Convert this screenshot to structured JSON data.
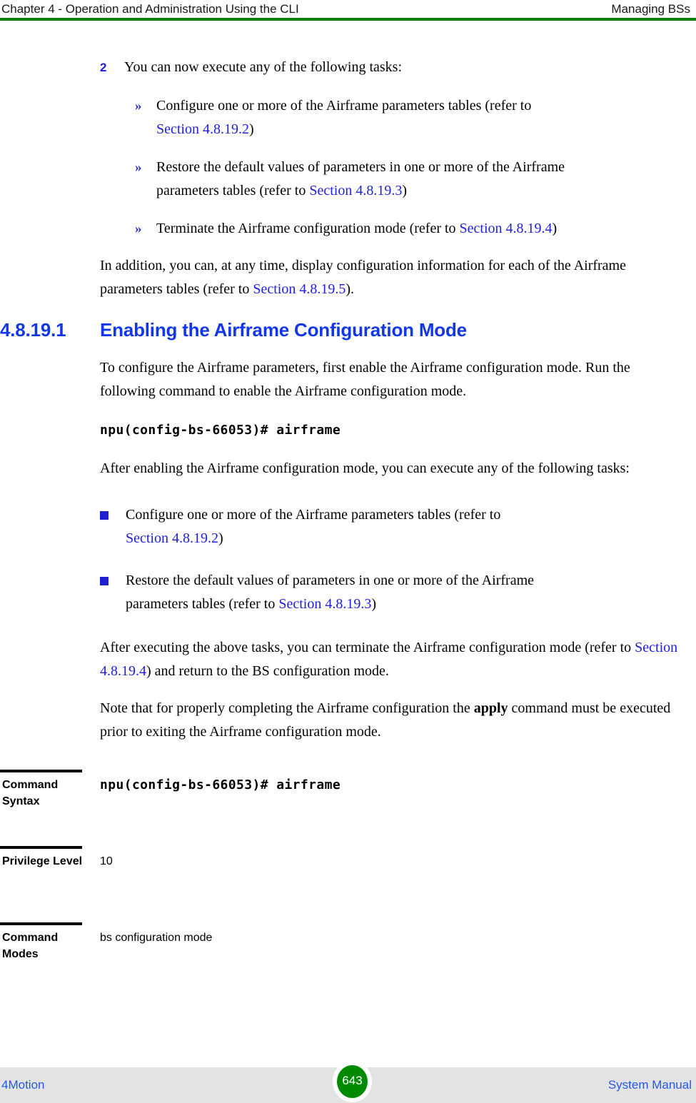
{
  "header": {
    "left": "Chapter 4 - Operation and Administration Using the CLI",
    "right": "Managing BSs",
    "rule_color": "#008000"
  },
  "step": {
    "number": "2",
    "text": "You can now execute any of the following tasks:"
  },
  "chevron_items": [
    {
      "marker": "»",
      "line1": "Configure one or more of the Airframe parameters tables (refer to",
      "ref": "Section 4.8.19.2",
      "tail": ")"
    },
    {
      "marker": "»",
      "line1": "Restore the default values of parameters in one or more of the Airframe",
      "line2_prefix": "parameters tables (refer to ",
      "ref": "Section 4.8.19.3",
      "tail": ")"
    },
    {
      "marker": "»",
      "line1_prefix": " Terminate the Airframe configuration mode (refer to ",
      "ref": "Section 4.8.19.4",
      "tail": ")"
    }
  ],
  "intro_paragraph": {
    "prefix": "In addition, you can, at any time, display configuration information for each of the Airframe parameters tables (refer to ",
    "ref": "Section 4.8.19.5",
    "tail": ")."
  },
  "section": {
    "number": "4.8.19.1",
    "title": "Enabling the Airframe Configuration Mode",
    "color": "#1137e8"
  },
  "paragraphs": {
    "configure_intro": "To configure the Airframe parameters, first enable the Airframe configuration mode. Run the following command to enable the Airframe configuration mode.",
    "command": "npu(config-bs-66053)# airframe",
    "after_enabling": "After enabling the Airframe configuration mode, you can execute any of the following tasks:"
  },
  "square_items": [
    {
      "line1": "Configure one or more of the Airframe parameters tables (refer to",
      "ref": "Section 4.8.19.2",
      "tail": ")"
    },
    {
      "line1": "Restore the default values of parameters in one or more of the Airframe",
      "line2_prefix": "parameters tables (refer to ",
      "ref": "Section 4.8.19.3",
      "tail": ")"
    }
  ],
  "closing": {
    "after_tasks_prefix": "After executing the above tasks, you can terminate the Airframe configuration mode (refer to ",
    "after_tasks_ref": "Section 4.8.19.4",
    "after_tasks_tail": ") and return to the BS configuration mode.",
    "note_prefix": "Note that for properly completing the Airframe configuration the ",
    "note_bold": "apply",
    "note_tail": " command must be executed prior to exiting the Airframe configuration mode."
  },
  "spec_table": {
    "rows": [
      {
        "label": "Command Syntax",
        "value": "npu(config-bs-66053)# airframe",
        "mono": true
      },
      {
        "label": "Privilege Level",
        "value": "10",
        "mono": false
      },
      {
        "label": "Command Modes",
        "value": "bs configuration mode",
        "mono": false
      }
    ]
  },
  "footer": {
    "left": "4Motion",
    "page_number": "643",
    "right": "System Manual",
    "band_color": "#e3e3e3",
    "badge_color": "#008a00",
    "text_color": "#2558e8"
  }
}
